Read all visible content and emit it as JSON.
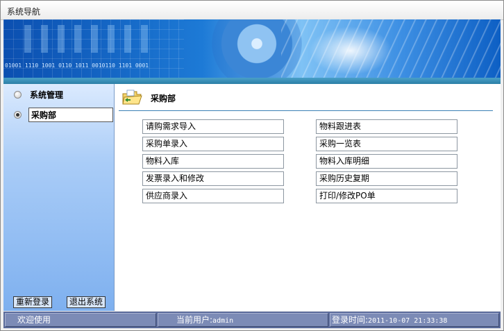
{
  "window": {
    "title": "系统导航"
  },
  "banner": {
    "digits": "01001 1110 1001 0110 1011 0010110 1101 0001"
  },
  "sidebar": {
    "items": [
      {
        "label": "系统管理",
        "selected": false
      },
      {
        "label": "采购部",
        "selected": true
      }
    ],
    "relogin_label": "重新登录",
    "exit_label": "退出系统"
  },
  "main": {
    "department_title": "采购部",
    "left_links": [
      "请购需求导入",
      "采购单录入",
      "物料入库",
      "发票录入和修改",
      "供应商录入"
    ],
    "right_links": [
      "物料跟进表",
      "采购一览表",
      "物料入库明细",
      "采购历史复期",
      "打印/修改PO单"
    ]
  },
  "status": {
    "welcome": "欢迎使用",
    "user_label": "当前用户:",
    "user_value": "admin",
    "login_label": "登录时间:",
    "login_value": "2011-10-07 21:33:38"
  }
}
